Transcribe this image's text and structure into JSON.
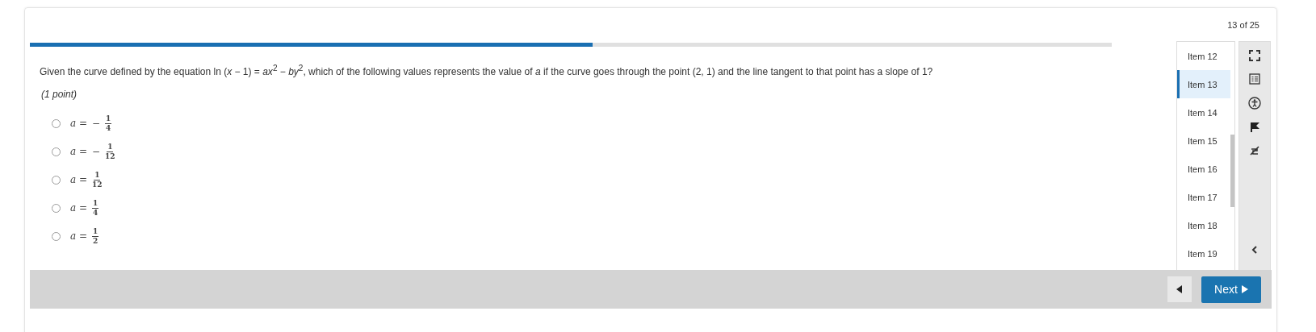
{
  "counter": "13 of 25",
  "progress": {
    "level": 0.52
  },
  "question": {
    "text": "Given the curve defined by the equation ln (*x* − 1) = *ax*$^{2}$ − *by*$^{2}$, which of the following values represents the value of *a* if the curve goes through the point (2, 1) and the line tangent to that point has a slope of 1?",
    "points": "(1 point)"
  },
  "options": [
    {
      "selected": false,
      "lhs": "a =",
      "sign": "−",
      "numerator": "1",
      "denominator": "4"
    },
    {
      "selected": false,
      "lhs": "a =",
      "sign": "−",
      "numerator": "1",
      "denominator": "12"
    },
    {
      "selected": false,
      "lhs": "a =",
      "numerator": "1",
      "denominator": "12"
    },
    {
      "selected": false,
      "lhs": "a =",
      "numerator": "1",
      "denominator": "4"
    },
    {
      "selected": false,
      "lhs": "a =",
      "numerator": "1",
      "denominator": "2"
    }
  ],
  "items": [
    {
      "label": "Item 12",
      "selected": false
    },
    {
      "label": "Item 13",
      "selected": true
    },
    {
      "label": "Item 14",
      "selected": false
    },
    {
      "label": "Item 15",
      "selected": false
    },
    {
      "label": "Item 16",
      "selected": false
    },
    {
      "label": "Item 17",
      "selected": false
    },
    {
      "label": "Item 18",
      "selected": false
    },
    {
      "label": "Item 19",
      "selected": false
    }
  ],
  "tools": [
    {
      "kind": "fullscreen"
    },
    {
      "kind": "list"
    },
    {
      "kind": "accessibility"
    },
    {
      "kind": "flag"
    },
    {
      "kind": "strike"
    }
  ],
  "footer": {
    "next": "Next"
  }
}
